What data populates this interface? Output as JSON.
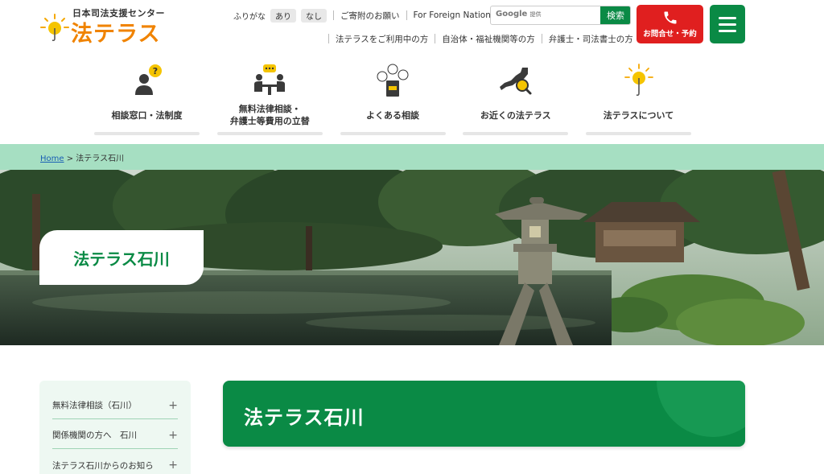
{
  "header": {
    "logo_sub": "日本司法支援センター",
    "logo_main": "法テラス",
    "furigana_label": "ふりがな",
    "furigana_on": "あり",
    "furigana_off": "なし",
    "donate_link": "ご寄附のお願い",
    "foreign_link": "For Foreign Nationals",
    "search_brand": "Google",
    "search_provided": "提供",
    "search_button": "検索",
    "audience_links": [
      "法テラスをご利用中の方",
      "自治体・福祉機関等の方",
      "弁護士・司法書士の方"
    ],
    "contact_label": "お問合せ・予約"
  },
  "nav": {
    "items": [
      {
        "label": "相談窓口・法制度",
        "icon": "person-question-icon"
      },
      {
        "label_line1": "無料法律相談・",
        "label_line2": "弁護士等費用の立替",
        "icon": "consultation-table-icon"
      },
      {
        "label": "よくある相談",
        "icon": "speech-bubbles-book-icon"
      },
      {
        "label": "お近くの法テラス",
        "icon": "japan-map-search-icon"
      },
      {
        "label": "法テラスについて",
        "icon": "sun-umbrella-icon"
      }
    ]
  },
  "breadcrumb": {
    "home": "Home",
    "separator": ">",
    "current": "法テラス石川"
  },
  "hero": {
    "title": "法テラス石川"
  },
  "sidebar": {
    "items": [
      {
        "label": "無料法律相談（石川）"
      },
      {
        "label": "関係機関の方へ　石川"
      },
      {
        "label": "法テラス石川からのお知ら"
      }
    ]
  },
  "main": {
    "title": "法テラス石川"
  },
  "colors": {
    "brand_green": "#0a8a45",
    "brand_orange": "#f08300",
    "contact_red": "#e01f1f",
    "breadcrumb_bg": "#a6dfc2"
  }
}
